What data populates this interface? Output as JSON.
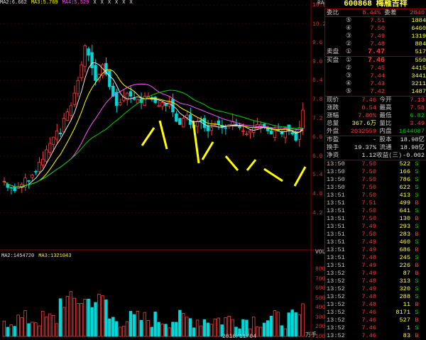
{
  "chart": {
    "ma_legend": [
      {
        "label": "MA2:6.662",
        "color": "#e8e8e8"
      },
      {
        "label": "MA3:5.769",
        "color": "#ffff00"
      },
      {
        "label": "MA4:5.529",
        "color": "#ff55ff"
      },
      {
        "label": "X",
        "color": "#e8e8e8"
      },
      {
        "label": "X",
        "color": "#e8e8e8"
      },
      {
        "label": "X",
        "color": "#e8e8e8"
      },
      {
        "label": "X",
        "color": "#e8e8e8"
      },
      {
        "label": "X",
        "color": "#e8e8e8"
      },
      {
        "label": "X",
        "color": "#e8e8e8"
      }
    ],
    "price_axis": [
      "10.8",
      "10.2",
      "9.6",
      "9.0",
      "8.4",
      "7.8",
      "7.2",
      "6.6",
      "6.0",
      "5.4",
      "4.8",
      "4.2"
    ],
    "price_axis_tag": "RA",
    "vol_legend": [
      {
        "label": "MA2:1454720",
        "color": "#e8e8e8"
      },
      {
        "label": "MA3:1321043",
        "color": "#ffff00"
      }
    ],
    "vol_axis": [
      "VOL",
      "800",
      "700",
      "600",
      "500",
      "400",
      "300",
      "200",
      "100",
      "万手"
    ],
    "bottom_date": "2016/11/04"
  },
  "chart_data": {
    "type": "candlestick",
    "price_axis_ticks": [
      10.8,
      10.2,
      9.6,
      9.0,
      8.4,
      7.8,
      7.2,
      6.6,
      6.0,
      5.4,
      4.8,
      4.2
    ],
    "volume_axis_ticks_wanshou": [
      800,
      700,
      600,
      500,
      400,
      300,
      200,
      100
    ],
    "close_last": 7.46,
    "ma": {
      "MA2": 6.662,
      "MA3": 5.769,
      "MA4": 5.529
    },
    "vol_ma": {
      "MA2": 1454720,
      "MA3": 1321043
    }
  },
  "panel": {
    "code": "600868",
    "name": "梅雁吉祥",
    "weibi_label": "委比",
    "weibi_value": "8.44%",
    "weicha_label": "委差",
    "weicha_value": "2840",
    "sells": [
      {
        "n": "⑤",
        "price": "7.51",
        "vol": "1884"
      },
      {
        "n": "④",
        "price": "7.50",
        "vol": "6460"
      },
      {
        "n": "③",
        "price": "7.49",
        "vol": "1319"
      },
      {
        "n": "②",
        "price": "7.48",
        "vol": "884"
      },
      {
        "n": "①",
        "price": "7.47",
        "vol": "517",
        "label": "卖盘"
      }
    ],
    "buys": [
      {
        "n": "①",
        "price": "7.46",
        "vol": "550",
        "label": "买盘"
      },
      {
        "n": "②",
        "price": "7.45",
        "vol": "4415"
      },
      {
        "n": "③",
        "price": "7.44",
        "vol": "3441"
      },
      {
        "n": "④",
        "price": "7.43",
        "vol": "3211"
      },
      {
        "n": "⑤",
        "price": "7.42",
        "vol": "1487"
      }
    ],
    "quote": [
      {
        "k": "现价",
        "v1": "7.46",
        "k2": "今开",
        "v2": "7.13",
        "c1": "red",
        "c2": "red"
      },
      {
        "k": "涨跌",
        "v1": "0.54",
        "k2": "最高",
        "v2": "7.58",
        "c1": "red",
        "c2": "red"
      },
      {
        "k": "涨幅",
        "v1": "7.80%",
        "k2": "最低",
        "v2": "6.82",
        "c1": "red",
        "c2": "grn"
      },
      {
        "k": "总量",
        "v1": "367.6万",
        "k2": "量比",
        "v2": "3.49",
        "c1": "yel",
        "c2": "red"
      },
      {
        "k": "外盘",
        "v1": "2032559",
        "k2": "内盘",
        "v2": "1644087",
        "c1": "red",
        "c2": "grn"
      }
    ],
    "stats": [
      {
        "k": "市盈",
        "v1": "-",
        "k2": "股本",
        "v2": "18.98亿"
      },
      {
        "k": "换手",
        "v1": "19.37%",
        "k2": "流通",
        "v2": "18.98亿"
      },
      {
        "k": "净资",
        "v1": "1.12",
        "k2": "收益(三)",
        "v2": "-0.002"
      }
    ],
    "trades": [
      {
        "t": "13:50",
        "p": "7.50",
        "v": "522",
        "f": "S"
      },
      {
        "t": "13:50",
        "p": "7.50",
        "v": "166",
        "f": "S"
      },
      {
        "t": "13:50",
        "p": "7.50",
        "v": "786",
        "f": "S"
      },
      {
        "t": "13:50",
        "p": "7.50",
        "v": "622",
        "f": "S"
      },
      {
        "t": "13:51",
        "p": "7.50",
        "v": "413",
        "f": "S"
      },
      {
        "t": "13:51",
        "p": "7.51",
        "v": "499",
        "f": "B"
      },
      {
        "t": "13:51",
        "p": "7.50",
        "v": "641",
        "f": "S"
      },
      {
        "t": "13:51",
        "p": "7.50",
        "v": "130",
        "f": "B"
      },
      {
        "t": "13:51",
        "p": "7.49",
        "v": "293",
        "f": "S"
      },
      {
        "t": "13:51",
        "p": "7.50",
        "v": "283",
        "f": "B"
      },
      {
        "t": "13:51",
        "p": "7.49",
        "v": "460",
        "f": "S"
      },
      {
        "t": "13:51",
        "p": "7.49",
        "v": "686",
        "f": "B"
      },
      {
        "t": "13:51",
        "p": "7.48",
        "v": "245",
        "f": "S"
      },
      {
        "t": "13:51",
        "p": "7.49",
        "v": "226",
        "f": "B"
      },
      {
        "t": "13:52",
        "p": "7.49",
        "v": "87",
        "f": "B"
      },
      {
        "t": "13:52",
        "p": "7.48",
        "v": "313",
        "f": "S"
      },
      {
        "t": "13:52",
        "p": "7.49",
        "v": "320",
        "f": "S"
      },
      {
        "t": "13:52",
        "p": "7.48",
        "v": "288",
        "f": "S"
      },
      {
        "t": "13:52",
        "p": "7.48",
        "v": "11",
        "f": "B"
      },
      {
        "t": "13:52",
        "p": "7.46",
        "v": "8171",
        "f": "S"
      },
      {
        "t": "13:52",
        "p": "7.46",
        "v": "527",
        "f": "B"
      },
      {
        "t": "13:52",
        "p": "7.46",
        "v": "1",
        "f": "S"
      },
      {
        "t": "13:52",
        "p": "7.46",
        "v": "83",
        "f": "B"
      }
    ]
  }
}
